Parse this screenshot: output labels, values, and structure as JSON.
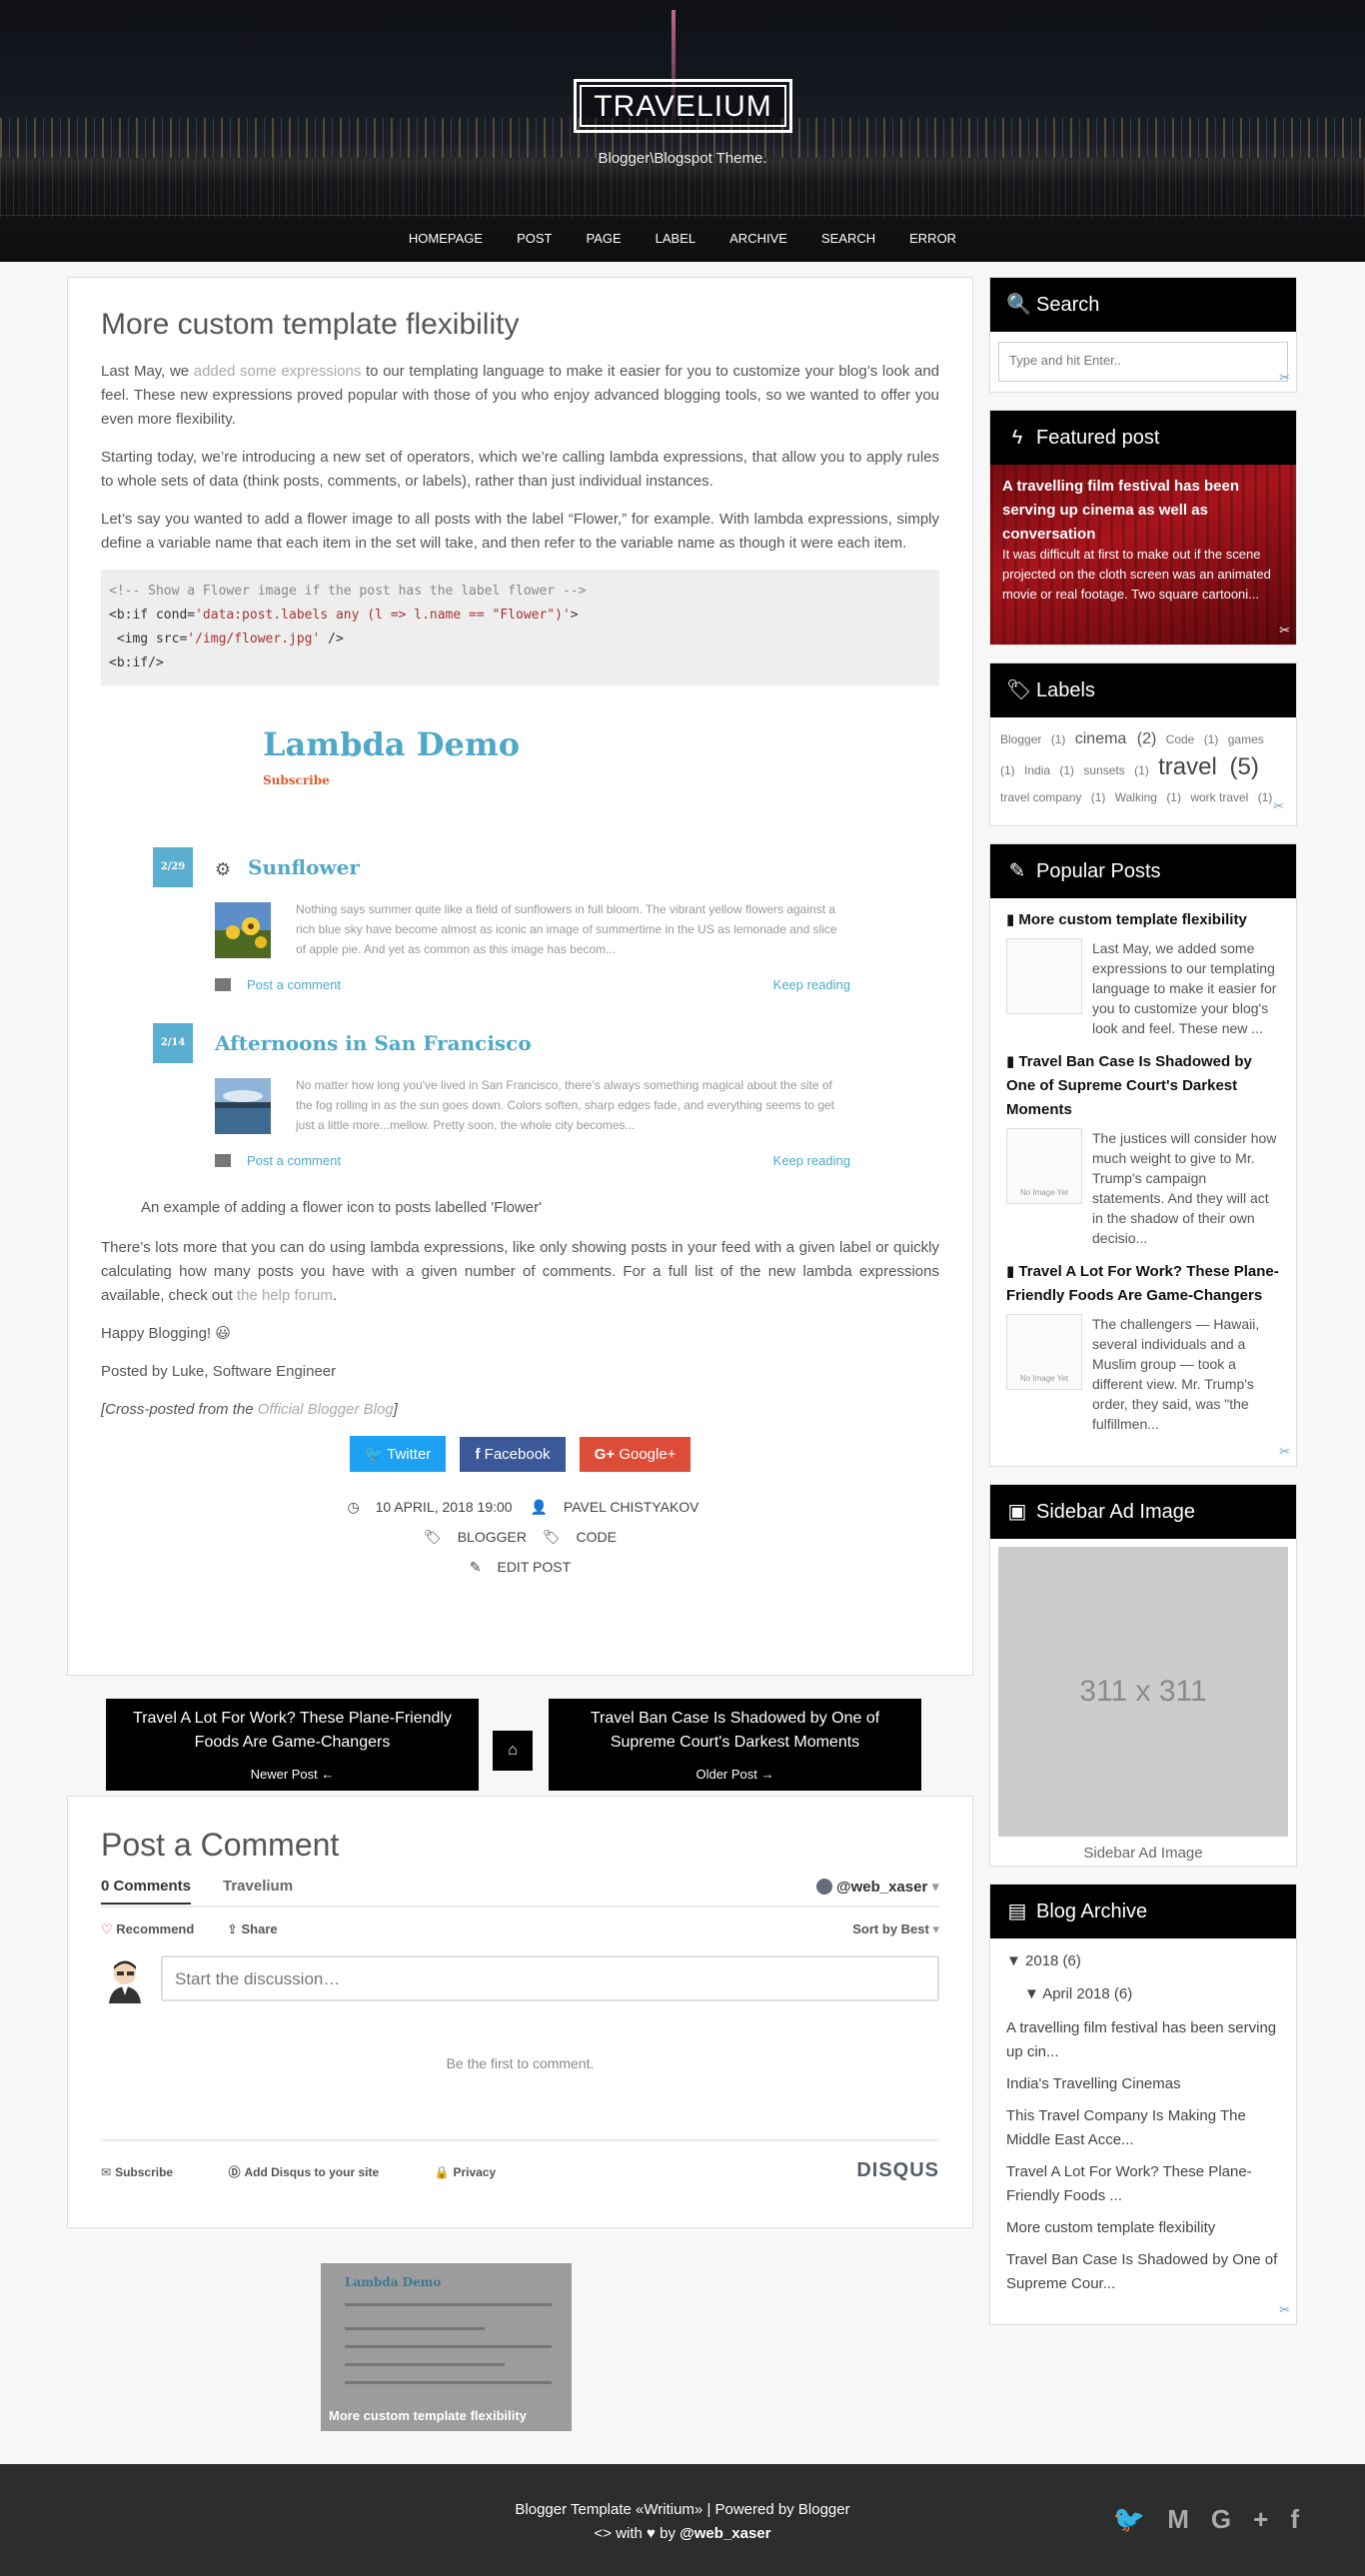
{
  "header": {
    "logo": "TRAVELIUM",
    "tagline": "Blogger\\Blogspot Theme.",
    "nav": [
      "HOMEPAGE",
      "POST",
      "PAGE",
      "LABEL",
      "ARCHIVE",
      "SEARCH",
      "ERROR"
    ]
  },
  "post": {
    "title": "More custom template flexibility",
    "p1_a": "Last May, we ",
    "p1_link": "added some expressions",
    "p1_b": " to our templating language to make it easier for you to customize your blog’s look and feel. These new expressions proved popular with those of you who enjoy advanced blogging tools, so we wanted to offer you even more flexibility.",
    "p2": "Starting today, we’re introducing a new set of operators, which we’re calling lambda expressions, that allow you to apply rules to whole sets of data (think posts, comments, or labels), rather than just individual instances.",
    "p3": "Let’s say you wanted to add a flower image to all posts with the label “Flower,” for example. With lambda expressions, simply define a variable name that each item in the set will take, and then refer to the variable name as though it were each item.",
    "code": {
      "l1": "<!-- Show a Flower image if the post has the label flower -->",
      "l2a": "<b:if cond=",
      "l2b": "'data:post.labels any (l => l.name == \"Flower\")'",
      "l2c": ">",
      "l3a": " <img src=",
      "l3b": "'/img/flower.jpg'",
      "l3c": " />",
      "l4": "<b:if/>"
    },
    "demo": {
      "title": "Lambda Demo",
      "subscribe": "Subscribe",
      "posts": [
        {
          "date": "2/29",
          "title": "Sunflower",
          "text": "Nothing says summer quite like a field of sunflowers in full bloom. The vibrant yellow flowers against a rich blue sky have become almost as iconic an image of summertime in the US as lemonade and slice of apple pie. And yet as common as this image has becom...",
          "comment": "Post a comment",
          "keep": "Keep reading"
        },
        {
          "date": "2/14",
          "title": "Afternoons in San Francisco",
          "text": "No matter how long you've lived in San Francisco, there's always something magical about the site of the fog rolling in as the sun goes down. Colors soften, sharp edges fade, and everything seems to get just a little more...mellow. Pretty soon, the whole city becomes...",
          "comment": "Post a comment",
          "keep": "Keep reading"
        }
      ]
    },
    "caption": "An example of adding a flower icon to posts labelled 'Flower'",
    "p4_a": "There’s lots more that you can do using lambda expressions, like only showing posts in your feed with a given label or quickly calculating how many posts you have with a given number of comments. For a full list of the new lambda expressions available, check out ",
    "p4_link": "the help forum",
    "p4_b": ".",
    "p5": "Happy Blogging! 😃",
    "p6": "Posted by Luke, Software Engineer",
    "p7_a": "[Cross-posted from the ",
    "p7_link": "Official Blogger Blog",
    "p7_b": "]",
    "share": {
      "twitter": "Twitter",
      "facebook": "Facebook",
      "google": "Google+"
    },
    "meta": {
      "date": "10 APRIL, 2018 19:00",
      "author": "PAVEL CHISTYAKOV",
      "label1": "BLOGGER",
      "label2": "CODE",
      "edit": "EDIT POST"
    }
  },
  "pager": {
    "newer_title": "Travel A Lot For Work? These Plane-Friendly Foods Are Game-Changers",
    "newer_label": "Newer Post",
    "older_title": "Travel Ban Case Is Shadowed by One of Supreme Court's Darkest Moments",
    "older_label": "Older Post"
  },
  "comments": {
    "heading": "Post a Comment",
    "tab_count": "0 Comments",
    "tab_site": "Travelium",
    "user": "@web_xaser",
    "recommend": "Recommend",
    "share": "Share",
    "sort": "Sort by Best",
    "placeholder": "Start the discussion…",
    "empty": "Be the first to comment.",
    "subscribe": "Subscribe",
    "add_disqus": "Add Disqus to your site",
    "privacy": "Privacy",
    "brand": "DISQUS"
  },
  "related": {
    "title": "More custom template flexibility",
    "mini_title": "Lambda Demo"
  },
  "sidebar": {
    "search": {
      "title": "Search",
      "placeholder": "Type and hit Enter.."
    },
    "featured": {
      "title": "Featured post",
      "post_title": "A travelling film festival has been serving up cinema as well as conversation",
      "post_text": "It was difficult at first to make out if the scene projected on the cloth screen was an animated movie or real footage. Two square cartooni..."
    },
    "labels": {
      "title": "Labels",
      "items": [
        {
          "name": "Blogger",
          "count": "(1)"
        },
        {
          "name": "cinema",
          "count": "(2)"
        },
        {
          "name": "Code",
          "count": "(1)"
        },
        {
          "name": "games",
          "count": "(1)"
        },
        {
          "name": "India",
          "count": "(1)"
        },
        {
          "name": "sunsets",
          "count": "(1)"
        },
        {
          "name": "travel",
          "count": "(5)"
        },
        {
          "name": "travel company",
          "count": "(1)"
        },
        {
          "name": "Walking",
          "count": "(1)"
        },
        {
          "name": "work travel",
          "count": "(1)"
        }
      ]
    },
    "popular": {
      "title": "Popular Posts",
      "posts": [
        {
          "title": "More custom template flexibility",
          "text": "Last May, we added some expressions to our templating language to make it easier for you to customize your blog's look and feel. These new ..."
        },
        {
          "title": "Travel Ban Case Is Shadowed by One of Supreme Court's Darkest Moments",
          "text": "The justices will consider how much weight to give to Mr. Trump's campaign statements. And they will act in the shadow of their own decisio..."
        },
        {
          "title": "Travel A Lot For Work? These Plane-Friendly Foods Are Game-Changers",
          "text": "The challengers — Hawaii, several individuals and a Muslim group — took a different view. Mr. Trump's order, they said, was \"the fulfillmen..."
        }
      ],
      "no_image": "No Image Yet"
    },
    "ad": {
      "title": "Sidebar Ad Image",
      "size": "311 x 311",
      "caption": "Sidebar Ad Image"
    },
    "archive": {
      "title": "Blog Archive",
      "year": "2018 (6)",
      "month": "April 2018 (6)",
      "items": [
        "A travelling film festival has been serving up cin...",
        "India's Travelling Cinemas",
        "This Travel Company Is Making The Middle East Acce...",
        "Travel A Lot For Work? These Plane-Friendly Foods ...",
        "More custom template flexibility",
        "Travel Ban Case Is Shadowed by One of Supreme Cour..."
      ]
    }
  },
  "footer": {
    "line1": "Blogger Template «Writium» | Powered by Blogger",
    "line2_a": "with",
    "line2_b": "by",
    "line2_user": "@web_xaser"
  }
}
